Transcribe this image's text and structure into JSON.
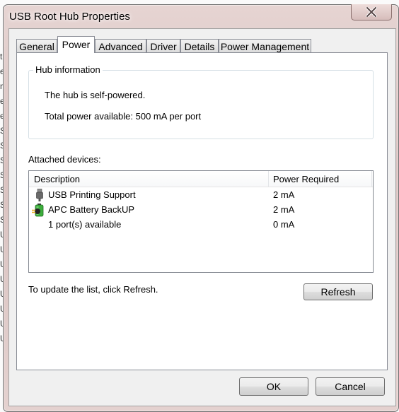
{
  "window": {
    "title": "USB Root Hub Properties",
    "close_icon": "close-icon"
  },
  "tabs": [
    {
      "label": "General",
      "active": false
    },
    {
      "label": "Power",
      "active": true
    },
    {
      "label": "Advanced",
      "active": false
    },
    {
      "label": "Driver",
      "active": false
    },
    {
      "label": "Details",
      "active": false
    },
    {
      "label": "Power Management",
      "active": false
    }
  ],
  "hub_info": {
    "group_title": "Hub information",
    "line1": "The hub is self-powered.",
    "line2": "Total power available:  500 mA per port"
  },
  "attached": {
    "label": "Attached devices:",
    "columns": [
      "Description",
      "Power Required"
    ],
    "rows": [
      {
        "icon": "usb-plug-icon",
        "description": "USB Printing Support",
        "power": "2 mA"
      },
      {
        "icon": "battery-backup-icon",
        "description": "APC Battery BackUP",
        "power": "2 mA"
      },
      {
        "icon": "",
        "description": "1 port(s) available",
        "power": "0 mA"
      }
    ]
  },
  "refresh": {
    "hint": "To update the list, click Refresh.",
    "button_label": "Refresh"
  },
  "footer": {
    "ok_label": "OK",
    "cancel_label": "Cancel"
  }
}
